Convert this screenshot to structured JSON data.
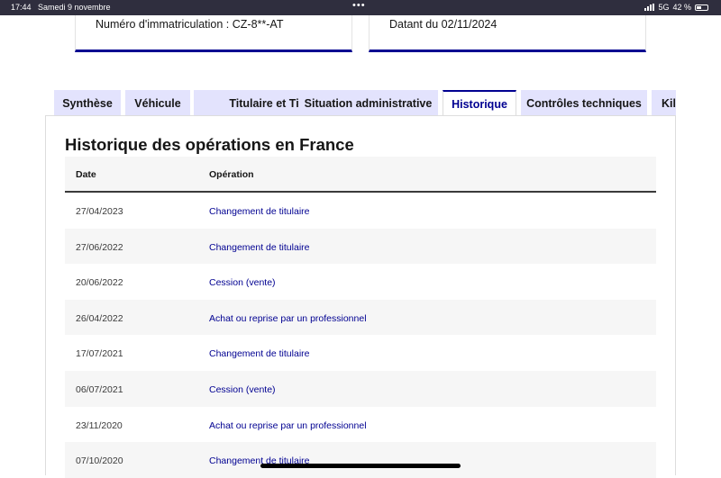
{
  "status_bar": {
    "time": "17:44",
    "date": "Samedi 9 novembre",
    "network": "5G",
    "battery": "42 %"
  },
  "cards": {
    "registration": "Numéro d'immatriculation : CZ-8**-AT",
    "dated": "Datant du 02/11/2024"
  },
  "tabs": [
    {
      "label": "Synthèse",
      "active": false
    },
    {
      "label": "Véhicule",
      "active": false
    },
    {
      "label": "Titulaire et Titre",
      "active": false
    },
    {
      "label": "Situation administrative",
      "active": false
    },
    {
      "label": "Historique",
      "active": true
    },
    {
      "label": "Contrôles techniques",
      "active": false
    },
    {
      "label": "Kilométrage",
      "active": false
    }
  ],
  "history": {
    "title": "Historique des opérations en France",
    "columns": {
      "date": "Date",
      "operation": "Opération"
    },
    "rows": [
      {
        "date": "27/04/2023",
        "operation": "Changement de titulaire"
      },
      {
        "date": "27/06/2022",
        "operation": "Changement de titulaire"
      },
      {
        "date": "20/06/2022",
        "operation": "Cession (vente)"
      },
      {
        "date": "26/04/2022",
        "operation": "Achat ou reprise par un professionnel"
      },
      {
        "date": "17/07/2021",
        "operation": "Changement de titulaire"
      },
      {
        "date": "06/07/2021",
        "operation": "Cession (vente)"
      },
      {
        "date": "23/11/2020",
        "operation": "Achat ou reprise par un professionnel"
      },
      {
        "date": "07/10/2020",
        "operation": "Changement de titulaire"
      }
    ]
  },
  "colors": {
    "accent": "#000091",
    "tab_inactive_bg": "#e3e3fd",
    "status_bar_bg": "#2f2e3e",
    "row_stripe": "#f6f6f6"
  }
}
